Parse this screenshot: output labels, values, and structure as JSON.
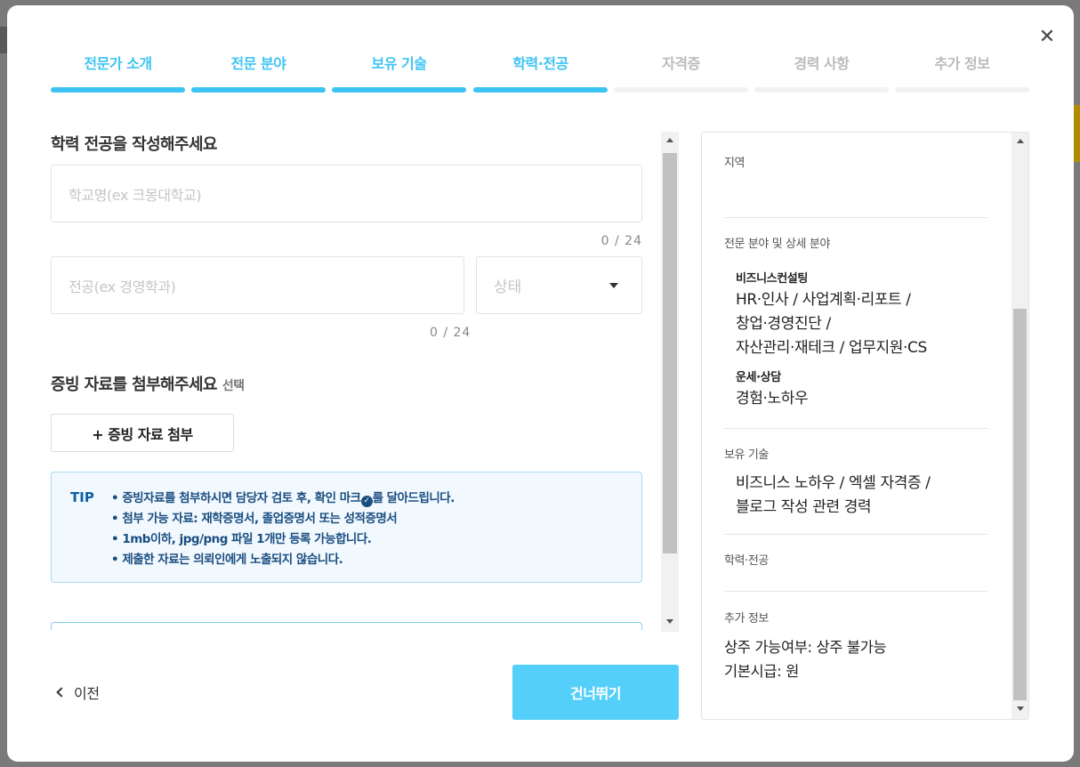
{
  "modal": {
    "close_icon": "✕"
  },
  "steps": [
    {
      "label": "전문가 소개",
      "done": true
    },
    {
      "label": "전문 분야",
      "done": true
    },
    {
      "label": "보유 기술",
      "done": true
    },
    {
      "label": "학력·전공",
      "done": true
    },
    {
      "label": "자격증",
      "done": false
    },
    {
      "label": "경력 사항",
      "done": false
    },
    {
      "label": "추가 정보",
      "done": false
    }
  ],
  "education": {
    "title": "학력 전공을 작성해주세요",
    "school_placeholder": "학교명(ex 크몽대학교)",
    "school_counter": "0 / 24",
    "major_placeholder": "전공(ex 경영학과)",
    "major_counter": "0 / 24",
    "status_placeholder": "상태"
  },
  "attachment": {
    "title": "증빙 자료를 첨부해주세요",
    "optional": "선택",
    "button_label": "+ 증빙 자료 첨부"
  },
  "tip": {
    "label": "TIP",
    "line1_before": "• 증빙자료를 첨부하시면 담당자 검토 후, 확인 마크",
    "line1_after": "를 달아드립니다.",
    "line2": "• 첨부 가능 자료: 재학증명서, 졸업증명서 또는 성적증명서",
    "line3": "• 1mb이하, jpg/png 파일 1개만 등록 가능합니다.",
    "line4": "• 제출한 자료는 의뢰인에게 노출되지 않습니다."
  },
  "footer": {
    "prev_label": "이전",
    "skip_label": "건너뛰기"
  },
  "preview": {
    "region_head": "지역",
    "field_head": "전문 분야 및 상세 분야",
    "group1_title": "비즈니스컨설팅",
    "group1_line1": "HR·인사  / 사업계획·리포트  /",
    "group1_line2": "창업·경영진단  /",
    "group1_line3": "자산관리·재테크  / 업무지원·CS",
    "group2_title": "운세·상담",
    "group2_line1": "경험·노하우",
    "skills_head": "보유 기술",
    "skills_line1": "비즈니스 노하우 / 엑셀 자격증 /",
    "skills_line2": "블로그 작성 관련 경력",
    "edu_head": "학력·전공",
    "extra_head": "추가 정보",
    "extra_line1": "상주 가능여부: 상주 불가능",
    "extra_line2": "기본시급: 원"
  },
  "colors": {
    "accent": "#3ec4f2",
    "skip_button": "#54cffa",
    "tip_text": "#1a4d80"
  }
}
